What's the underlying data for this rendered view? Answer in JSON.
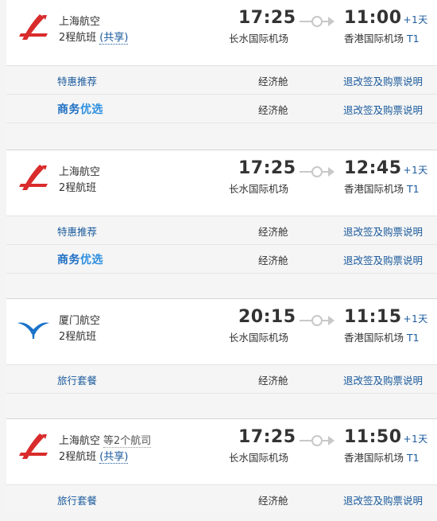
{
  "colors": {
    "link": "#1a5a9c",
    "accent_red": "#d92b2b",
    "xiamen_blue": "#1a73c8"
  },
  "flights": [
    {
      "logo": "shanghai-airlines-logo",
      "airline": "上海航空",
      "extra": "",
      "transfer": "2程航班",
      "shared": "(共享)",
      "dep_time": "17:25",
      "dep_airport": "长水国际机场",
      "arr_time": "11:00",
      "plus_day": "+1天",
      "arr_airport": "香港国际机场",
      "terminal": "T1",
      "offers": [
        {
          "type": "特惠推荐",
          "biz": false,
          "cabin": "经济舱",
          "rules": "退改签及购票说明"
        },
        {
          "type_a": "商务",
          "type_b": "优选",
          "biz": true,
          "cabin": "经济舱",
          "rules": "退改签及购票说明"
        }
      ]
    },
    {
      "logo": "shanghai-airlines-logo",
      "airline": "上海航空",
      "extra": "",
      "transfer": "2程航班",
      "shared": "",
      "dep_time": "17:25",
      "dep_airport": "长水国际机场",
      "arr_time": "12:45",
      "plus_day": "+1天",
      "arr_airport": "香港国际机场",
      "terminal": "T1",
      "offers": [
        {
          "type": "特惠推荐",
          "biz": false,
          "cabin": "经济舱",
          "rules": "退改签及购票说明"
        },
        {
          "type_a": "商务",
          "type_b": "优选",
          "biz": true,
          "cabin": "经济舱",
          "rules": "退改签及购票说明"
        }
      ]
    },
    {
      "logo": "xiamen-airlines-logo",
      "airline": "厦门航空",
      "extra": "",
      "transfer": "2程航班",
      "shared": "",
      "dep_time": "20:15",
      "dep_airport": "长水国际机场",
      "arr_time": "11:15",
      "plus_day": "+1天",
      "arr_airport": "香港国际机场",
      "terminal": "T1",
      "offers": [
        {
          "type": "旅行套餐",
          "biz": false,
          "cabin": "经济舱",
          "rules": "退改签及购票说明"
        }
      ]
    },
    {
      "logo": "shanghai-airlines-logo",
      "airline": "上海航空",
      "extra": "等2个航司",
      "transfer": "2程航班",
      "shared": "(共享)",
      "dep_time": "17:25",
      "dep_airport": "长水国际机场",
      "arr_time": "11:50",
      "plus_day": "+1天",
      "arr_airport": "香港国际机场",
      "terminal": "T1",
      "offers": [
        {
          "type": "旅行套餐",
          "biz": false,
          "cabin": "经济舱",
          "rules": "退改签及购票说明"
        }
      ]
    }
  ]
}
